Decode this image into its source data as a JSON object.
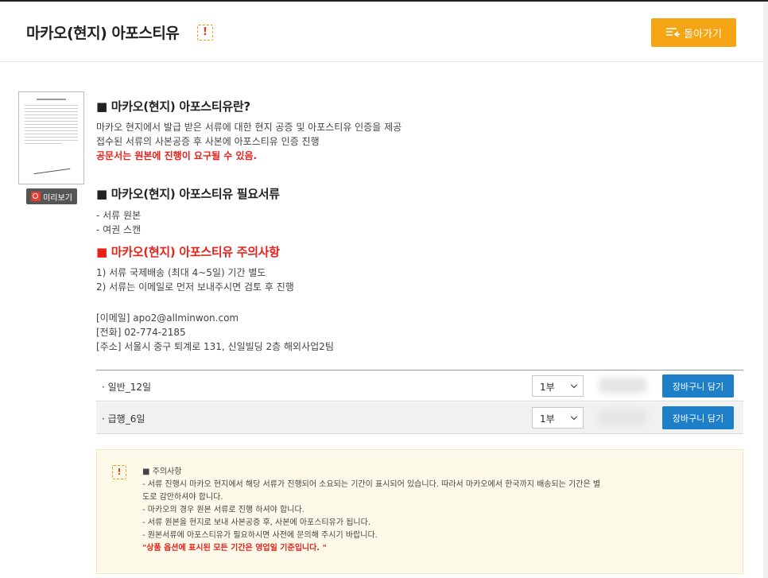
{
  "header": {
    "title": "마카오(현지) 아포스티유",
    "warning_icon": "!",
    "back_label": "돌아가기"
  },
  "preview": {
    "label": "미리보기"
  },
  "section1": {
    "heading": "■ 마카오(현지) 아포스티유란?",
    "lines": [
      "마카오 현지에서 발급 받은 서류에 대한 현지 공증 및 아포스티유 인증을 제공",
      "접수된 서류의 사본공증 후 사본에 아포스티유 인증 진행"
    ],
    "notice": "공문서는 원본에 진행이 요구될 수 있음."
  },
  "section2": {
    "heading": "■ 마카오(현지) 아포스티유 필요서류",
    "lines": [
      "- 서류 원본",
      "- 여권 스캔"
    ]
  },
  "section3": {
    "heading": "■ 마카오(현지) 아포스티유 주의사항",
    "lines": [
      "1) 서류 국제배송 (최대 4~5일) 기간 별도",
      "2) 서류는 이메일로 먼저 보내주시면 검토 후 진행"
    ]
  },
  "contact": {
    "email": "[이메일] apo2@allminwon.com",
    "phone": "[전화] 02-774-2185",
    "address": "[주소] 서울시 중구 퇴계로 131, 신일빌딩 2층 해외사업2팀"
  },
  "options": [
    {
      "name": "· 일반_12일",
      "qty": "1부",
      "cart_label": "장바구니 담기"
    },
    {
      "name": "· 급행_6일",
      "qty": "1부",
      "cart_label": "장바구니 담기"
    }
  ],
  "notice_box": {
    "warning_icon": "!",
    "title": "■ 주의사항",
    "lines": [
      "- 서류 진행시 마카오 현지에서 해당 서류가 진행되어 소요되는 기간이 표시되어 있습니다. 따라서 마카오에서 한국까지 배송되는 기간은 별",
      "도로 감안하셔야 합니다.",
      "- 마카오의 경우 원본 서류로 진행 하셔야 합니다.",
      "- 서류 원본을 현지로 보내 사본공증 후, 사본에 아포스티유가 됩니다.",
      "- 원본서류에 아포스티유가 필요하시면 사전에 문의해 주시기 바랍니다."
    ],
    "emphasis": "\"상품 옵션에 표시된 모든 기간은 영업일 기준입니다. \""
  },
  "colors": {
    "accent_orange": "#f5a414",
    "cart_blue": "#1e7fc9",
    "alert_red": "#e8211b",
    "notice_bg": "#fdfaea"
  }
}
